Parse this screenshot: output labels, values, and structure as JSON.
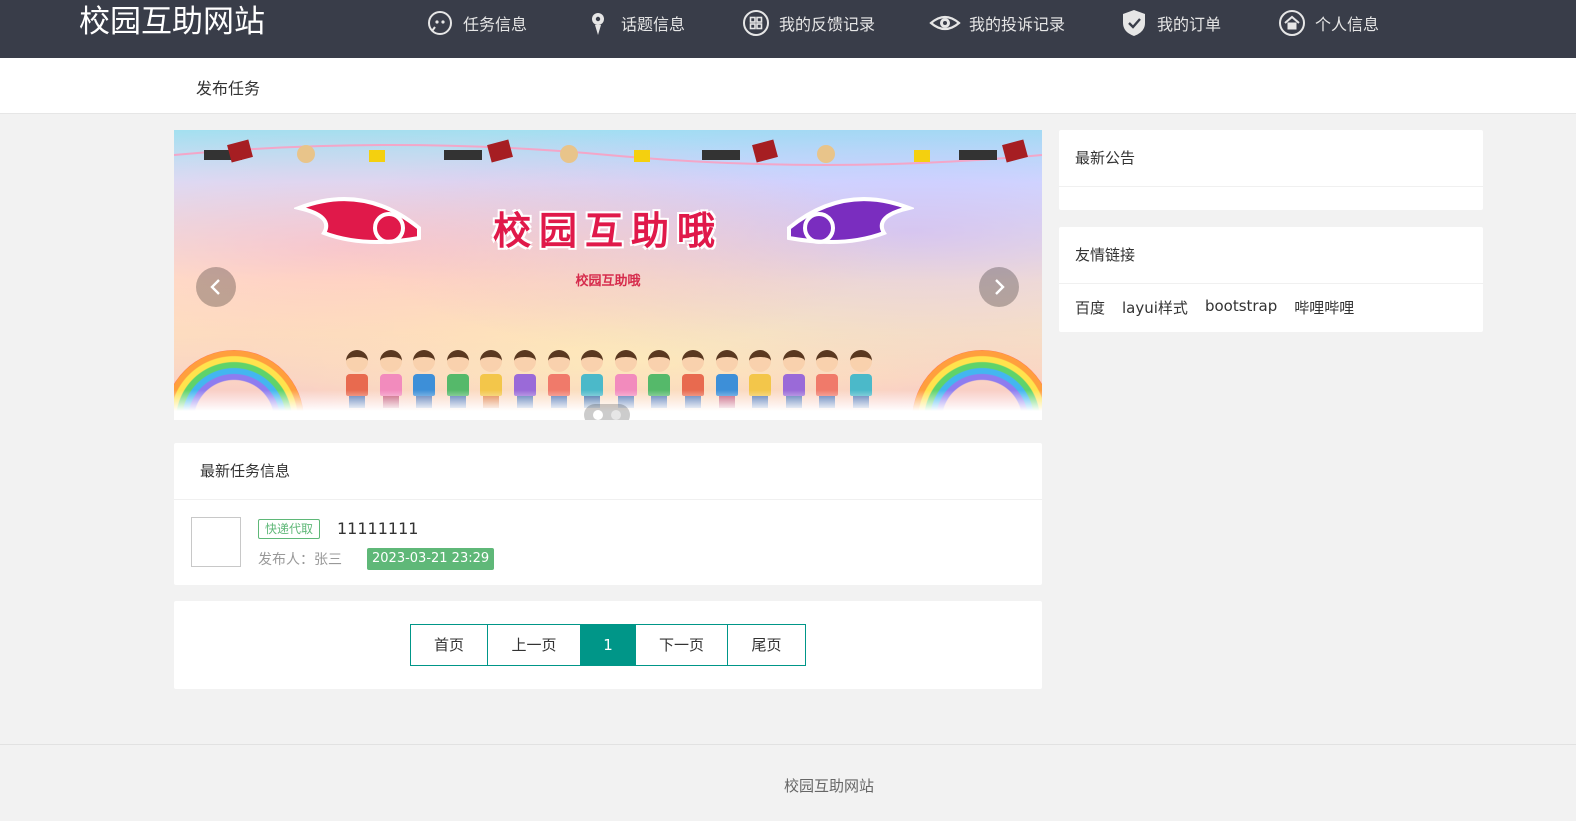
{
  "header": {
    "logo": "校园互助网站",
    "nav": [
      {
        "label": "任务信息",
        "icon": "chat-icon"
      },
      {
        "label": "话题信息",
        "icon": "bulb-icon"
      },
      {
        "label": "我的反馈记录",
        "icon": "apps-icon"
      },
      {
        "label": "我的投诉记录",
        "icon": "eye-icon"
      },
      {
        "label": "我的订单",
        "icon": "shield-check-icon"
      },
      {
        "label": "个人信息",
        "icon": "home-icon"
      }
    ]
  },
  "subnav": {
    "publish_task": "发布任务"
  },
  "carousel": {
    "title": "校园互助哦",
    "subtitle": "校园互助哦",
    "prev_icon": "chevron-left-icon",
    "next_icon": "chevron-right-icon",
    "active_dot": 0
  },
  "tasks": {
    "heading": "最新任务信息",
    "items": [
      {
        "tag": "快递代取",
        "title": "11111111",
        "publisher": "发布人：张三",
        "time": "2023-03-21 23:29"
      }
    ]
  },
  "pagination": {
    "first": "首页",
    "prev": "上一页",
    "current": "1",
    "next": "下一页",
    "last": "尾页",
    "accent": "#009688"
  },
  "sidebar": {
    "notice_heading": "最新公告",
    "links_heading": "友情链接",
    "links": [
      "百度",
      "layui样式",
      "bootstrap",
      "哔哩哔哩"
    ]
  },
  "footer": {
    "text": "校园互助网站"
  },
  "colors": {
    "header_bg": "#393d49",
    "tag_green": "#5fb878",
    "page_bg": "#f2f2f2"
  }
}
